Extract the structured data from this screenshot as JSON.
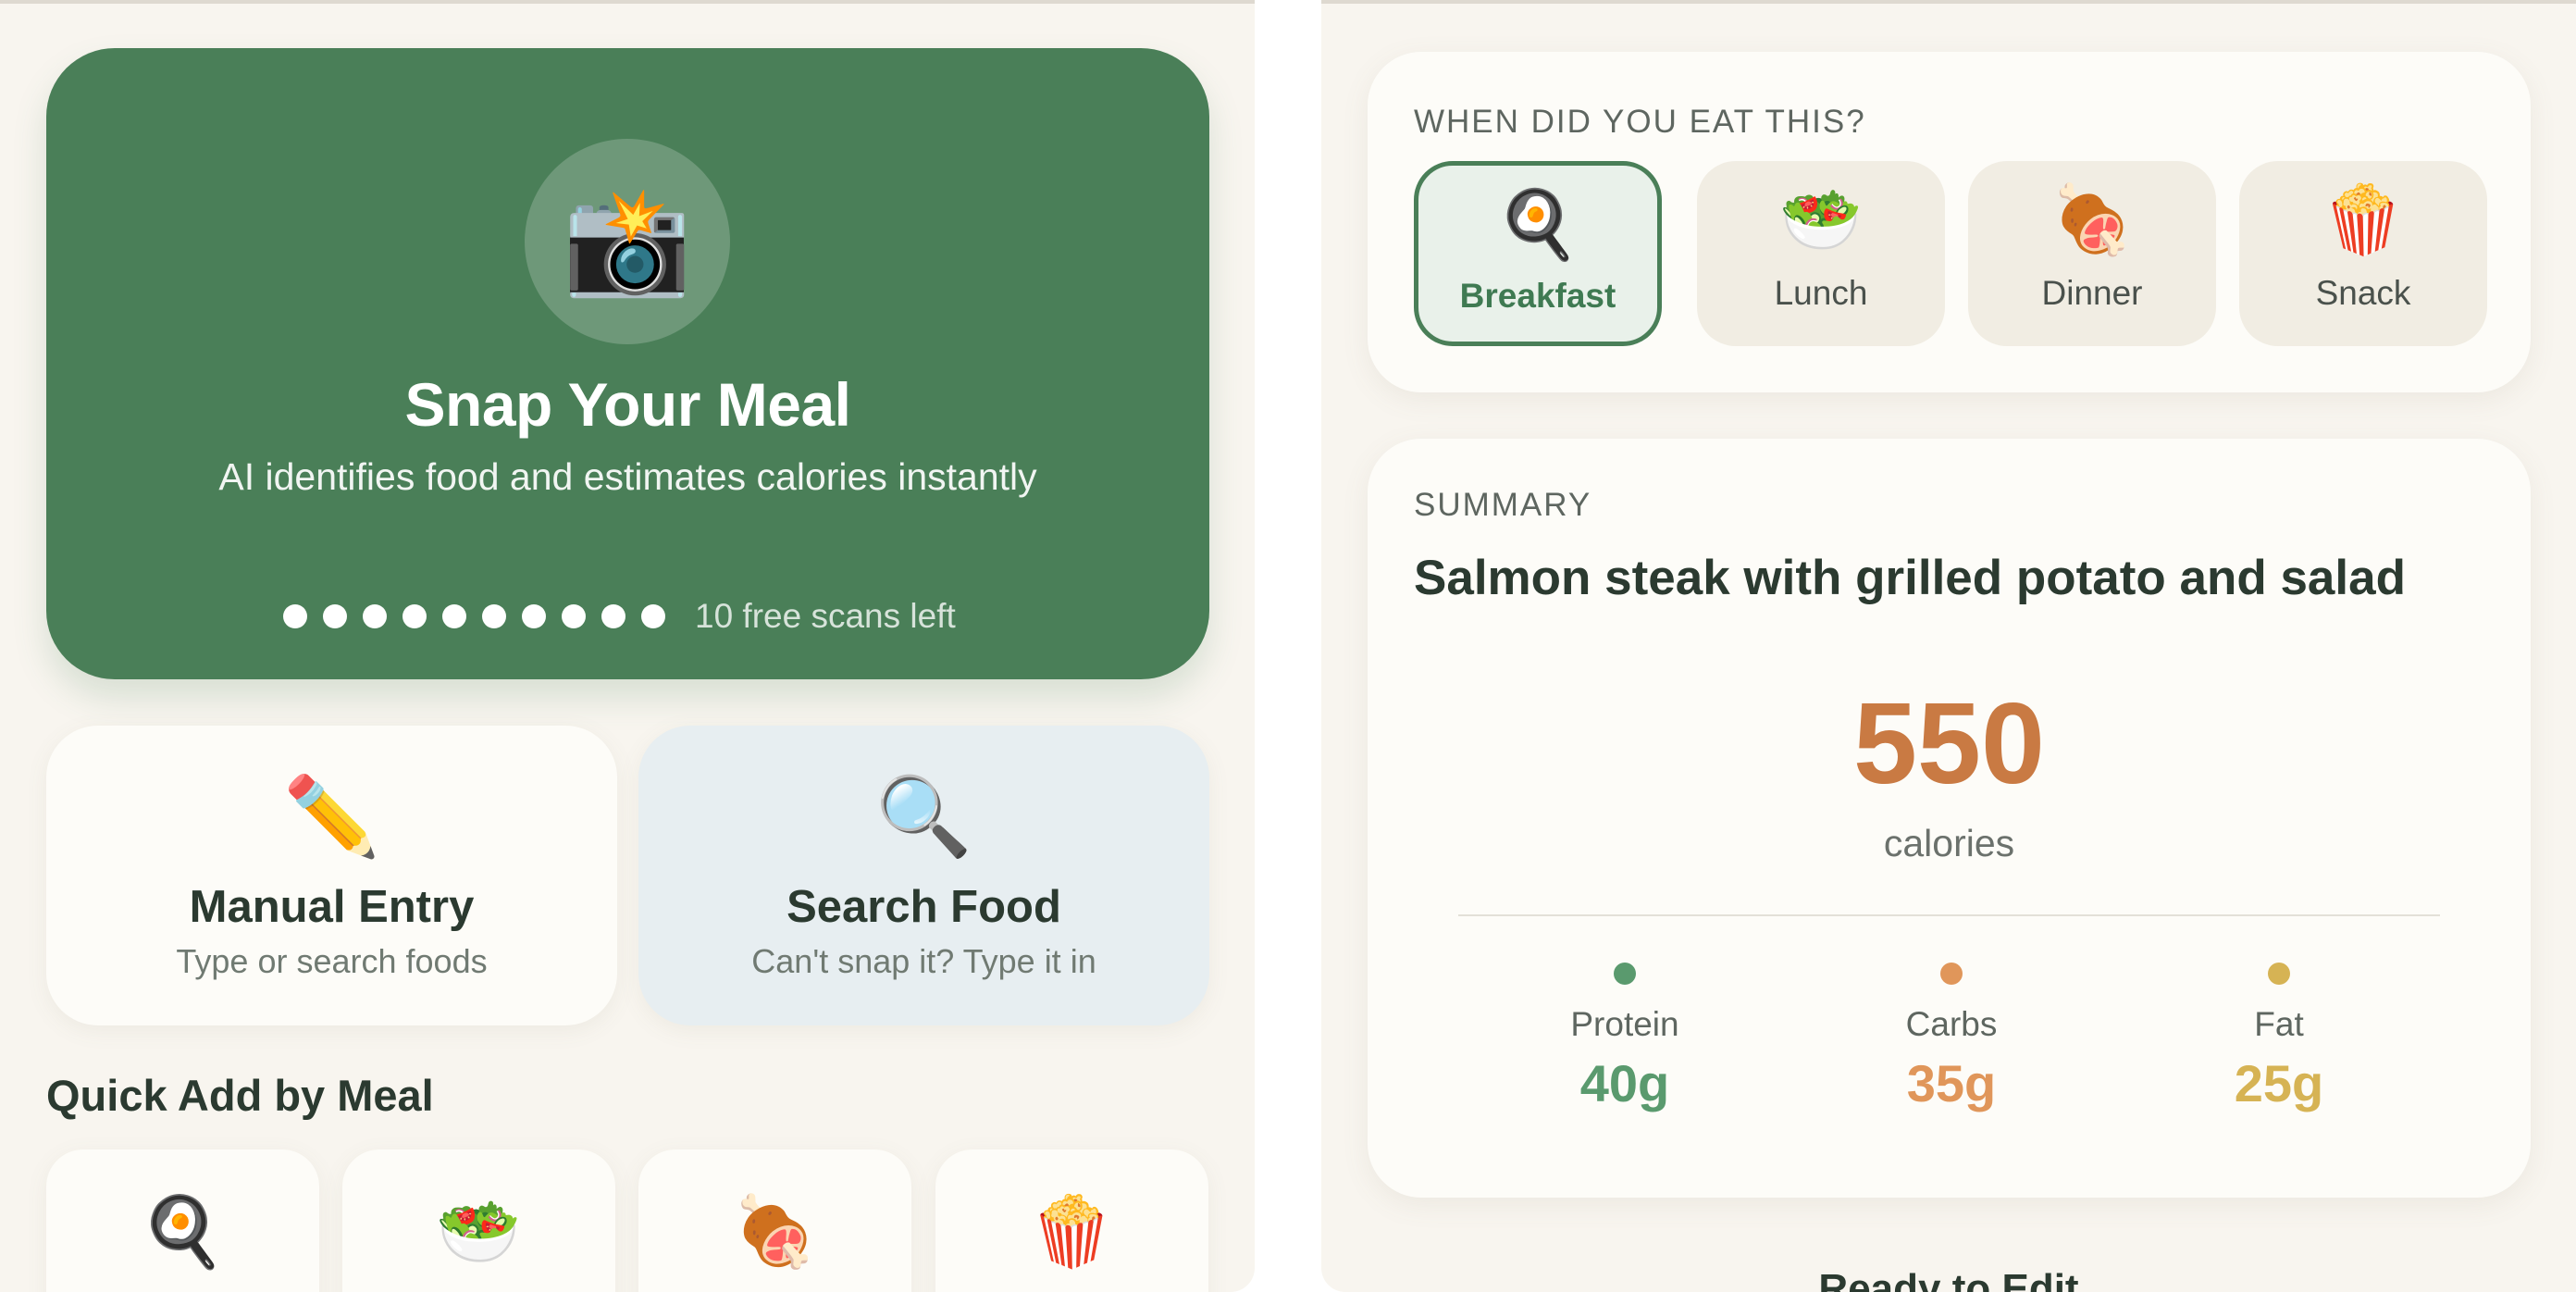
{
  "left": {
    "hero": {
      "icon": "camera-flash-icon",
      "icon_glyph": "📸",
      "title": "Snap Your Meal",
      "subtitle": "AI identifies food and estimates calories instantly",
      "scans_remaining": 10,
      "scans_text": "10 free scans left"
    },
    "actions": [
      {
        "icon": "pencil-icon",
        "icon_glyph": "✏️",
        "title": "Manual Entry",
        "subtitle": "Type or search foods"
      },
      {
        "icon": "magnifier-icon",
        "icon_glyph": "🔍",
        "title": "Search Food",
        "subtitle": "Can't snap it? Type it in"
      }
    ],
    "quick_add": {
      "heading": "Quick Add by Meal",
      "items": [
        {
          "icon": "fried-egg-icon",
          "icon_glyph": "🍳"
        },
        {
          "icon": "salad-icon",
          "icon_glyph": "🥗"
        },
        {
          "icon": "meat-drumstick-icon",
          "icon_glyph": "🍖"
        },
        {
          "icon": "popcorn-icon",
          "icon_glyph": "🍿"
        }
      ]
    }
  },
  "right": {
    "meal_time": {
      "label": "WHEN DID YOU EAT THIS?",
      "selected": "Breakfast",
      "options": [
        {
          "label": "Breakfast",
          "icon": "fried-egg-icon",
          "icon_glyph": "🍳"
        },
        {
          "label": "Lunch",
          "icon": "salad-icon",
          "icon_glyph": "🥗"
        },
        {
          "label": "Dinner",
          "icon": "meat-drumstick-icon",
          "icon_glyph": "🍖"
        },
        {
          "label": "Snack",
          "icon": "popcorn-icon",
          "icon_glyph": "🍿"
        }
      ]
    },
    "summary": {
      "label": "SUMMARY",
      "title": "Salmon steak with grilled potato and salad",
      "calories": "550",
      "calories_unit": "calories",
      "macros": [
        {
          "label": "Protein",
          "value": "40g",
          "color": "#5a9a6e"
        },
        {
          "label": "Carbs",
          "value": "35g",
          "color": "#e0965a"
        },
        {
          "label": "Fat",
          "value": "25g",
          "color": "#d6b354"
        }
      ]
    },
    "bottom_peek": "Ready to Edit"
  },
  "colors": {
    "brand_green": "#4a7f58",
    "background": "#f8f5ef",
    "card": "#fdfcf8",
    "calorie_orange": "#c97a43"
  }
}
